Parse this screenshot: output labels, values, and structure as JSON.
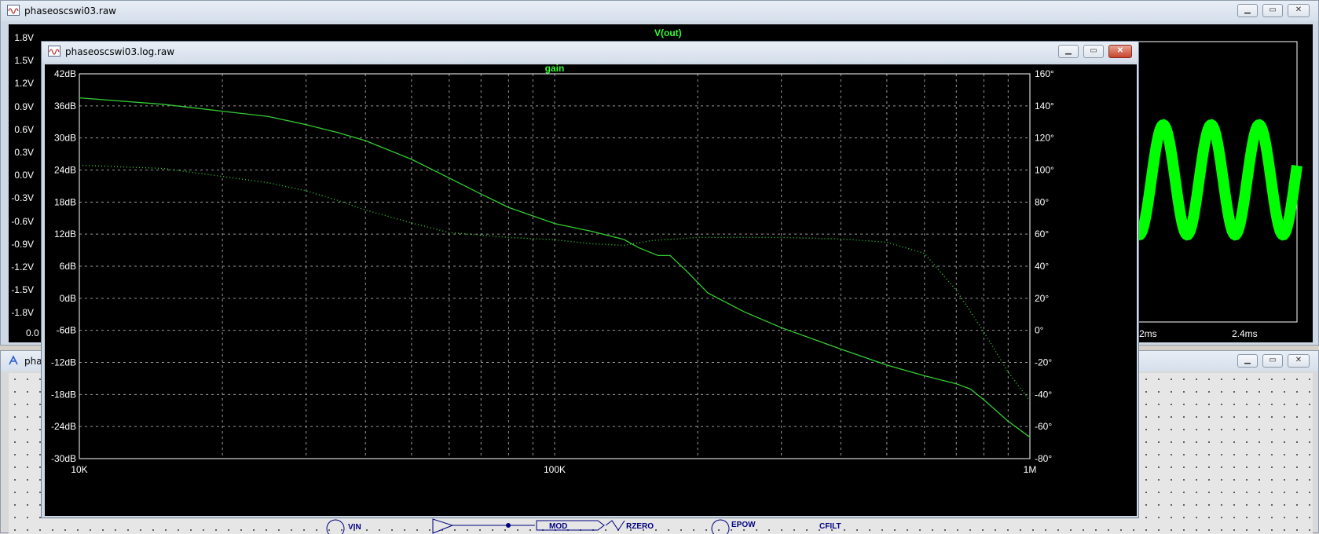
{
  "back_window": {
    "title": "phaseoscswi03.raw",
    "trace_label": "V(out)",
    "y_ticks": [
      "1.8V",
      "1.5V",
      "1.2V",
      "0.9V",
      "0.6V",
      "0.3V",
      "0.0V",
      "-0.3V",
      "-0.6V",
      "-0.9V",
      "-1.2V",
      "-1.5V",
      "-1.8V"
    ],
    "x_ticks_visible": [
      "0.0",
      "2ms",
      "2.4ms"
    ],
    "trace_colors": {
      "primary": "#00ff00",
      "secondary": "#0000ff"
    }
  },
  "schematic_window": {
    "title": "pha",
    "components": [
      "VIN",
      "MOD",
      "RZERO",
      "EPOW",
      "CFILT"
    ]
  },
  "front_window": {
    "title": "phaseoscswi03.log.raw",
    "trace_label": "gain",
    "chart_data": {
      "type": "line",
      "title": "gain",
      "x_scale": "log",
      "x_ticks": [
        "10K",
        "100K",
        "1M"
      ],
      "xlim": [
        10000,
        1000000
      ],
      "left_axis": {
        "unit": "dB",
        "ylim": [
          -30,
          42
        ],
        "ticks": [
          "42dB",
          "36dB",
          "30dB",
          "24dB",
          "18dB",
          "12dB",
          "6dB",
          "0dB",
          "-6dB",
          "-12dB",
          "-18dB",
          "-24dB",
          "-30dB"
        ]
      },
      "right_axis": {
        "unit": "°",
        "ylim": [
          -80,
          160
        ],
        "ticks": [
          "160°",
          "140°",
          "120°",
          "100°",
          "80°",
          "60°",
          "40°",
          "20°",
          "0°",
          "-20°",
          "-40°",
          "-60°",
          "-80°"
        ]
      },
      "grid": true,
      "series": [
        {
          "axis": "left",
          "style": "solid",
          "color": "#33cc33",
          "x": [
            10000,
            15000,
            20000,
            25000,
            30000,
            35000,
            40000,
            50000,
            60000,
            70000,
            80000,
            100000,
            120000,
            140000,
            150000,
            165000,
            175000,
            190000,
            210000,
            250000,
            300000,
            400000,
            500000,
            600000,
            700000,
            750000,
            800000,
            900000,
            1000000
          ],
          "y": [
            37.5,
            36.3,
            35,
            34,
            32.5,
            31,
            29.5,
            26,
            22.5,
            19.5,
            17,
            14,
            12.5,
            11,
            9.5,
            8,
            8,
            5,
            1,
            -2.5,
            -5.5,
            -9.5,
            -12.5,
            -14.5,
            -16,
            -17,
            -19,
            -23,
            -26
          ]
        },
        {
          "axis": "right",
          "style": "dotted",
          "color": "#33cc33",
          "x": [
            10000,
            15000,
            20000,
            25000,
            30000,
            35000,
            40000,
            50000,
            60000,
            80000,
            100000,
            120000,
            140000,
            160000,
            180000,
            200000,
            250000,
            300000,
            400000,
            500000,
            600000,
            700000,
            800000,
            900000,
            1000000
          ],
          "y": [
            103,
            101,
            96,
            92,
            87,
            81,
            75,
            67,
            61,
            58,
            56.5,
            54,
            53,
            56,
            57,
            58,
            58,
            58,
            57,
            55,
            48,
            25,
            -1,
            -26,
            -44
          ]
        }
      ]
    }
  }
}
